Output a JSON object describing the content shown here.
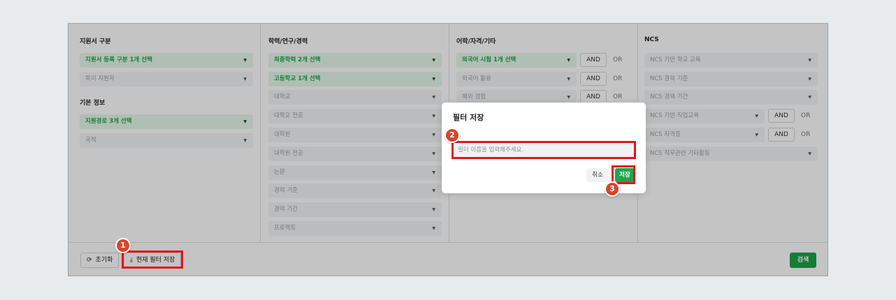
{
  "columns": [
    {
      "title": "지원서 구분",
      "selects": [
        {
          "label": "지원서 등록 구분 1개 선택",
          "active": true
        },
        {
          "label": "특이 지원자",
          "active": false
        }
      ],
      "subtitle": "기본 정보",
      "subselects": [
        {
          "label": "지원경로 3개 선택",
          "active": true
        },
        {
          "label": "국적",
          "active": false
        }
      ]
    },
    {
      "title": "학력/연구/경력",
      "selects": [
        {
          "label": "최종학력 2개 선택",
          "active": true
        },
        {
          "label": "고등학교 1개 선택",
          "active": true
        },
        {
          "label": "대학교",
          "active": false
        },
        {
          "label": "대학교 전공",
          "active": false
        },
        {
          "label": "대학원",
          "active": false
        },
        {
          "label": "대학원 전공",
          "active": false
        },
        {
          "label": "논문",
          "active": false
        },
        {
          "label": "경력 기준",
          "active": false
        },
        {
          "label": "경력 기간",
          "active": false
        },
        {
          "label": "프로젝트",
          "active": false
        }
      ]
    },
    {
      "title": "어학/자격/기타",
      "selects": [
        {
          "label": "외국어 시험 1개 선택",
          "active": true
        },
        {
          "label": "외국어 활용",
          "active": false
        },
        {
          "label": "해외 경험",
          "active": false
        }
      ]
    },
    {
      "title": "NCS",
      "selects": [
        {
          "label": "NCS 기반 학교 교육",
          "active": false
        },
        {
          "label": "NCS 경력 기준",
          "active": false
        },
        {
          "label": "NCS 경력 기간",
          "active": false
        },
        {
          "label": "NCS 기반 직업교육",
          "active": false
        },
        {
          "label": "NCS 자격증",
          "active": false
        },
        {
          "label": "NCS 직무관련 기타활동",
          "active": false
        }
      ]
    }
  ],
  "logic": {
    "and_label": "AND",
    "or_label": "OR"
  },
  "footer": {
    "reset_label": "초기화",
    "save_filter_label": "현재 필터 저장",
    "search_label": "검색"
  },
  "modal": {
    "title": "필터 저장",
    "input_placeholder": "필터 이름을 입력해주세요.",
    "cancel_label": "취소",
    "save_label": "저장"
  },
  "badges": [
    "1",
    "2",
    "3"
  ],
  "colors": {
    "accent": "#1ea64b",
    "highlight": "#e3131b",
    "badge": "#d9442b"
  }
}
